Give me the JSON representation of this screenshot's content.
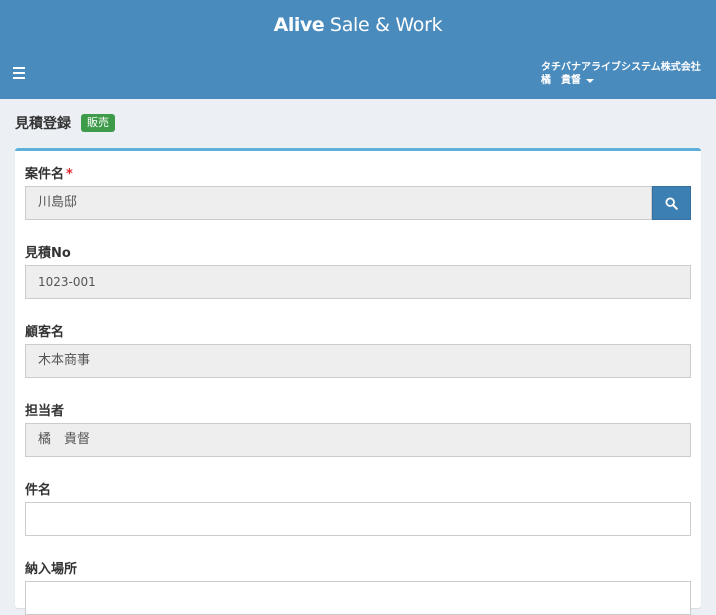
{
  "header": {
    "brand_bold": "Alive",
    "brand_rest": " Sale & Work",
    "company": "タチバナアライブシステム株式会社",
    "user_name": "橘　貴督",
    "menu_icon": "hamburger-icon",
    "colors": {
      "header_bg": "#4a8bbd",
      "accent": "#5db0d9"
    }
  },
  "page": {
    "title": "見積登録",
    "badge": "販売"
  },
  "form": {
    "project": {
      "label": "案件名",
      "required_mark": "*",
      "value": "川島邸",
      "search_icon": "search-icon"
    },
    "quote_no": {
      "label": "見積No",
      "value": "1023-001"
    },
    "customer": {
      "label": "顧客名",
      "value": "木本商事"
    },
    "staff": {
      "label": "担当者",
      "value": "橘　貴督"
    },
    "subject": {
      "label": "件名",
      "value": ""
    },
    "delivery_place": {
      "label": "納入場所",
      "value": ""
    }
  }
}
